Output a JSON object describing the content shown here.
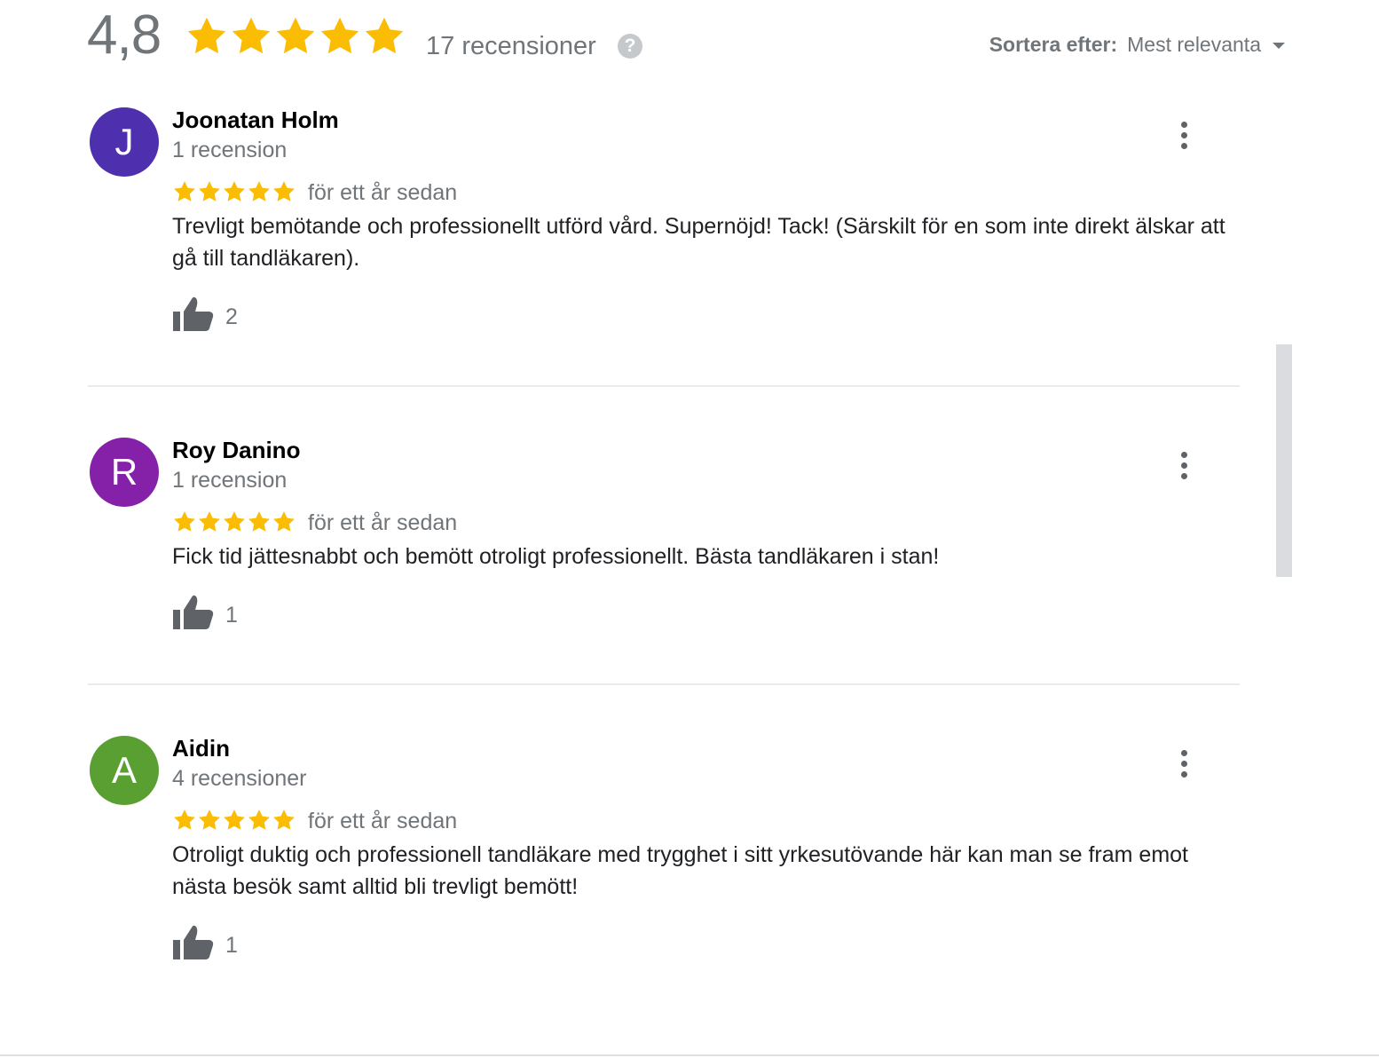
{
  "header": {
    "rating_value": "4,8",
    "star_rating": 4.8,
    "review_count_label": "17 recensioner",
    "help_icon": "help-circle-icon",
    "sort_label": "Sortera efter:",
    "sort_value": "Mest relevanta"
  },
  "colors": {
    "star": "#fbbc04",
    "text_secondary": "#70757a",
    "avatar_j": "#4e30ae",
    "avatar_r": "#8520a8",
    "avatar_a": "#5a9f32"
  },
  "reviews": [
    {
      "avatar_letter": "J",
      "name": "Joonatan Holm",
      "meta": "1 recension",
      "stars": 5,
      "date": "för ett år sedan",
      "text": "Trevligt bemötande och professionellt utförd vård. Supernöjd! Tack! (Särskilt för en som inte direkt älskar att gå till tandläkaren).",
      "likes": "2"
    },
    {
      "avatar_letter": "R",
      "name": "Roy Danino",
      "meta": "1 recension",
      "stars": 5,
      "date": "för ett år sedan",
      "text": "Fick tid jättesnabbt och bemött otroligt professionellt. Bästa tandläkaren i stan!",
      "likes": "1"
    },
    {
      "avatar_letter": "A",
      "name": "Aidin",
      "meta": "4 recensioner",
      "stars": 5,
      "date": "för ett år sedan",
      "text": "Otroligt duktig och professionell tandläkare med trygghet i sitt yrkesutövande här kan man se fram emot nästa besök samt alltid bli trevligt bemött!",
      "likes": "1"
    }
  ]
}
